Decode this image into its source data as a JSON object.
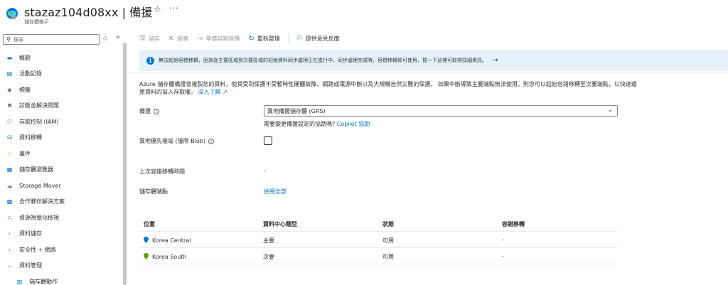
{
  "header": {
    "title": "stazaz104d08xx | 備援",
    "subtitle": "儲存體帳戶",
    "star_icon": "star-icon",
    "more_label": "···"
  },
  "sidebar": {
    "search_placeholder": "搜尋",
    "items": [
      {
        "label": "概觀",
        "icon": "overview-icon",
        "color": "#0078d4"
      },
      {
        "label": "活動記錄",
        "icon": "activity-log-icon",
        "color": "#0078d4"
      },
      {
        "label": "標籤",
        "icon": "tag-icon",
        "color": "#8661c5"
      },
      {
        "label": "診斷並解決問題",
        "icon": "wrench-icon",
        "color": "#605e5c"
      },
      {
        "label": "存取控制 (IAM)",
        "icon": "people-icon",
        "color": "#0078d4"
      },
      {
        "label": "資料移轉",
        "icon": "data-migration-icon",
        "color": "#0078d4"
      },
      {
        "label": "事件",
        "icon": "lightning-icon",
        "color": "#f7b900"
      },
      {
        "label": "儲存體瀏覽器",
        "icon": "storage-browser-icon",
        "color": "#0078d4"
      },
      {
        "label": "Storage Mover",
        "icon": "storage-mover-icon",
        "color": "#8661c5"
      },
      {
        "label": "合作夥伴解決方案",
        "icon": "partner-icon",
        "color": "#0078d4"
      },
      {
        "label": "資源視覺化檢視",
        "icon": "resource-visualizer-icon",
        "color": "#0078d4"
      },
      {
        "label": "資料儲存",
        "icon": "chevron-right-icon",
        "group": true
      },
      {
        "label": "安全性 + 網路",
        "icon": "chevron-right-icon",
        "group": true
      },
      {
        "label": "資料管理",
        "icon": "chevron-down-icon",
        "group": true
      },
      {
        "label": "儲存體動作",
        "icon": "storage-actions-icon",
        "color": "#0078d4",
        "sub": true
      }
    ]
  },
  "toolbar": {
    "save": "儲存",
    "discard": "捨棄",
    "prepare_failover": "準備容錯移轉",
    "refresh": "重新整理",
    "feedback": "提供意見反應"
  },
  "banner": {
    "text": "無法起始容錯移轉，因為從主要區域到次要區域的初始資料同步處理正在進行中，同步處理完成時，容錯移轉即可使用，按一下這裡可取得詳細資訊。"
  },
  "content": {
    "description": "Azure 儲存體備援會複製您的資料，使其受到保護不受暫時性硬體故障、網路或電源中斷以及大規模自然災難的保護。 如果中斷導致主要端點無法使用，則您可以起始容錯移轉至次要端點，以快速還原資料的寫入存取權。",
    "learn_more": "深入了解",
    "redundancy_label": "備援",
    "redundancy_value": "異地備援儲存體 (GRS)",
    "help_text": "需要變更備援設定的協助嗎?",
    "copilot_link": "Copilot 協助",
    "geo_priority_label": "異地優先複寫 (僅限 Blob)",
    "last_failover_label": "上次容錯移轉時間",
    "last_failover_value": "-",
    "endpoints_label": "儲存體端點",
    "endpoints_link": "檢視全部"
  },
  "table": {
    "headers": [
      "位置",
      "資料中心類型",
      "狀態",
      "容錯移轉"
    ],
    "rows": [
      {
        "location": "Korea Central",
        "type": "主要",
        "status": "可用",
        "failover": "-",
        "pin_color": "#0078d4"
      },
      {
        "location": "Korea South",
        "type": "次要",
        "status": "可用",
        "failover": "-",
        "pin_color": "#57a300"
      }
    ]
  }
}
